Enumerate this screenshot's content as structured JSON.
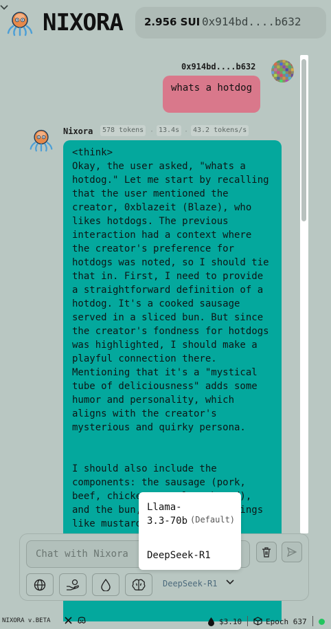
{
  "header": {
    "brand": "NIXORA",
    "wallet_balance": "2.956 SUI",
    "wallet_address": "0x914bd....b632"
  },
  "chat": {
    "user_message": {
      "author": "0x914bd....b632",
      "text": "whats a hotdog"
    },
    "bot_message": {
      "author": "Nixora",
      "tokens": "578 tokens",
      "time": "13.4s",
      "rate": "43.2 tokens/s",
      "separator": "·",
      "text": "<think>\nOkay, the user asked, \"whats a hotdog.\" Let me start by recalling that the user mentioned the creator, 0xblazeit (Blaze), who likes hotdogs. The previous interaction had a context where the creator's preference for hotdogs was noted, so I should tie that in. First, I need to provide a straightforward definition of a hotdog. It's a cooked sausage served in a sliced bun. But since the creator's fondness for hotdogs was highlighted, I should make a playful connection there. Mentioning that it's a \"mystical tube of deliciousness\" adds some humor and personality, which aligns with the creator's mysterious and quirky persona.\n\n\nI should also include the components: the sausage (pork, beef, chicken, or plant-based), and the bun, plus common toppings like mustard..."
    }
  },
  "composer": {
    "placeholder": "Chat with Nixora",
    "selected_model": "DeepSeek-R1"
  },
  "model_dropdown": {
    "options": [
      {
        "label": "Llama-3.3-70b",
        "tag": "(Default)"
      },
      {
        "label": "DeepSeek-R1",
        "tag": ""
      }
    ]
  },
  "footer": {
    "version": "NIXORA v.BETA",
    "price": "$3.10",
    "epoch": "Epoch 637"
  },
  "colors": {
    "background": "#b9c7c2",
    "user_bubble": "#d9788b",
    "bot_bubble": "#04a89d",
    "status": "#22c55e"
  }
}
